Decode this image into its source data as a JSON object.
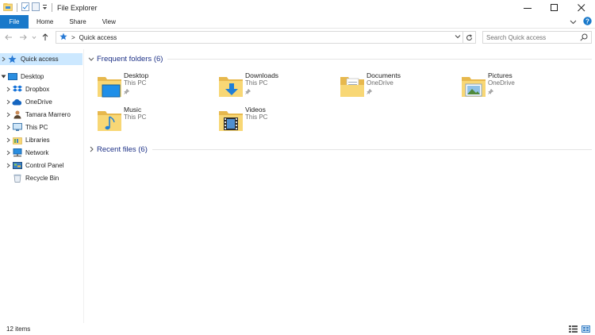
{
  "window": {
    "title": "File Explorer",
    "minimize_glyph": "—",
    "maximize_glyph": "□",
    "close_glyph": "✕"
  },
  "ribbon": {
    "tabs": [
      {
        "label": "File"
      },
      {
        "label": "Home"
      },
      {
        "label": "Share"
      },
      {
        "label": "View"
      }
    ],
    "expand_glyph": "∨",
    "help_glyph": "?"
  },
  "address": {
    "separator": ">",
    "location": "Quick access"
  },
  "search": {
    "placeholder": "Search Quick access"
  },
  "nav": {
    "items": [
      {
        "label": "Quick access",
        "icon": "star-icon"
      },
      {
        "label": "Desktop",
        "icon": "desktop-icon"
      },
      {
        "label": "Dropbox",
        "icon": "dropbox-icon"
      },
      {
        "label": "OneDrive",
        "icon": "onedrive-icon"
      },
      {
        "label": "Tamara Marrero",
        "icon": "user-icon"
      },
      {
        "label": "This PC",
        "icon": "computer-icon"
      },
      {
        "label": "Libraries",
        "icon": "libraries-icon"
      },
      {
        "label": "Network",
        "icon": "network-icon"
      },
      {
        "label": "Control Panel",
        "icon": "control-panel-icon"
      },
      {
        "label": "Recycle Bin",
        "icon": "recycle-bin-icon"
      }
    ]
  },
  "groups": {
    "frequent": {
      "label": "Frequent folders (6)",
      "folders": [
        {
          "name": "Desktop",
          "location": "This PC",
          "icon": "desktop-folder-icon"
        },
        {
          "name": "Downloads",
          "location": "This PC",
          "icon": "downloads-folder-icon"
        },
        {
          "name": "Documents",
          "location": "OneDrive",
          "icon": "documents-folder-icon"
        },
        {
          "name": "Pictures",
          "location": "OneDrive",
          "icon": "pictures-folder-icon"
        },
        {
          "name": "Music",
          "location": "This PC",
          "icon": "music-folder-icon"
        },
        {
          "name": "Videos",
          "location": "This PC",
          "icon": "videos-folder-icon"
        }
      ]
    },
    "recent": {
      "label": "Recent files (6)"
    }
  },
  "status": {
    "item_count": "12 items"
  },
  "colors": {
    "accent": "#1979ca",
    "selection": "#cce8ff",
    "group_header": "#1e3287",
    "folder": "#f8d775"
  }
}
